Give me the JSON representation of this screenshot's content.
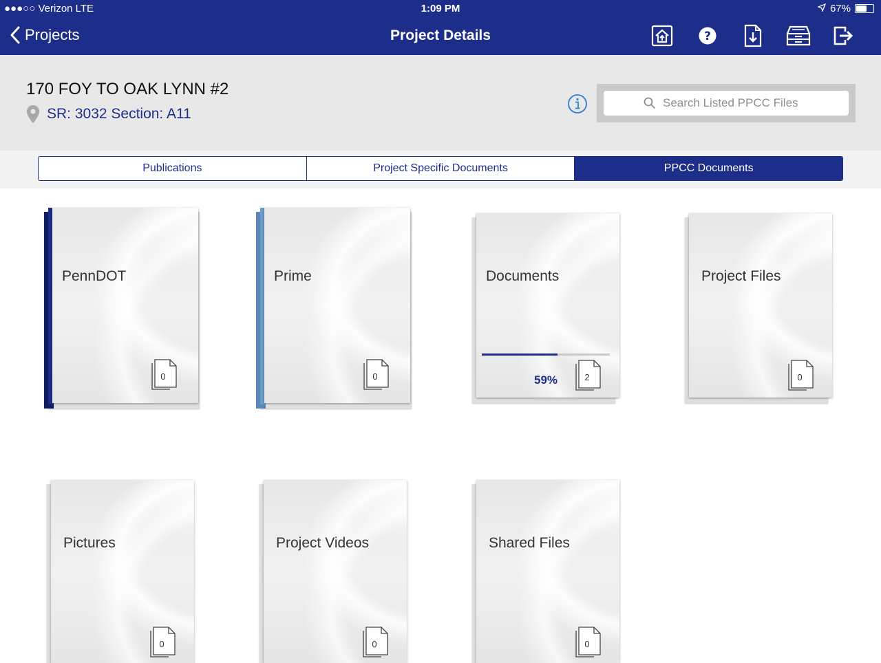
{
  "status": {
    "carrier": "●●●○○ Verizon  LTE",
    "time": "1:09 PM",
    "battery": "67%",
    "battery_level": 0.67
  },
  "nav": {
    "back_label": "Projects",
    "title": "Project Details"
  },
  "project": {
    "name": "170 FOY TO OAK LYNN #2",
    "sr": "SR: 3032 Section: A11"
  },
  "search": {
    "placeholder": "Search Listed PPCC Files",
    "value": ""
  },
  "tabs": [
    {
      "label": "Publications",
      "active": false
    },
    {
      "label": "Project Specific Documents",
      "active": false
    },
    {
      "label": "PPCC Documents",
      "active": true
    }
  ],
  "folders": [
    {
      "label": "PennDOT",
      "count": "0",
      "spine": "dark",
      "spine_color": "#1d2e8a"
    },
    {
      "label": "Prime",
      "count": "0",
      "spine": "light",
      "spine_color": "#6f9bc8"
    },
    {
      "label": "Documents",
      "count": "2",
      "progress": 0.59,
      "progress_label": "59%"
    },
    {
      "label": "Project Files",
      "count": "0"
    },
    {
      "label": "Pictures",
      "count": "0"
    },
    {
      "label": "Project Videos",
      "count": "0"
    },
    {
      "label": "Shared Files",
      "count": "0"
    }
  ],
  "colors": {
    "brand": "#1d2e8a",
    "header_bg": "#e8e8e8"
  },
  "icons": [
    "home-upload-icon",
    "help-icon",
    "download-file-icon",
    "archive-tray-icon",
    "logout-icon",
    "info-icon",
    "search-icon",
    "location-pin-icon",
    "document-count-icon"
  ]
}
